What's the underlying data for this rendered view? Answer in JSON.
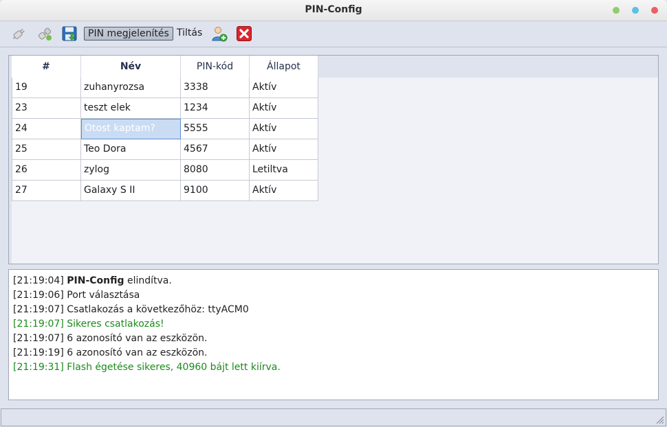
{
  "window": {
    "title": "PIN-Config"
  },
  "colors": {
    "dot_green": "#8fce6a",
    "dot_blue": "#5bc0eb",
    "dot_red": "#ec5f67",
    "success_text": "#1a8a1a"
  },
  "toolbar": {
    "icons": [
      "connect-plug-icon",
      "disconnect-plug-icon",
      "save-disk-icon",
      "add-user-icon",
      "delete-red-x-icon"
    ],
    "show_pin_label": "PIN megjelenítés",
    "block_label": "Tiltás"
  },
  "table": {
    "headers": [
      "#",
      "Név",
      "PIN-kód",
      "Állapot"
    ],
    "rows": [
      {
        "id": "19",
        "name": "zuhanyrozsa",
        "pin": "3338",
        "status": "Aktív"
      },
      {
        "id": "23",
        "name": "teszt elek",
        "pin": "1234",
        "status": "Aktív"
      },
      {
        "id": "24",
        "name": "Otost kaptam?",
        "pin": "5555",
        "status": "Aktív"
      },
      {
        "id": "25",
        "name": "Teo Dora",
        "pin": "4567",
        "status": "Aktív"
      },
      {
        "id": "26",
        "name": "zylog",
        "pin": "8080",
        "status": "Letiltva"
      },
      {
        "id": "27",
        "name": "Galaxy S II",
        "pin": "9100",
        "status": "Aktív"
      }
    ]
  },
  "log": [
    {
      "time": "[21:19:04]",
      "bold": "PIN-Config",
      "text": " elindítva."
    },
    {
      "time": "[21:19:06]",
      "text": " Port választása"
    },
    {
      "time": "[21:19:07]",
      "text": " Csatlakozás a következőhöz: ttyACM0"
    },
    {
      "time": "[21:19:07]",
      "text": " Sikeres csatlakozás!",
      "success": true
    },
    {
      "time": "[21:19:07]",
      "text": " 6 azonosító van az eszközön."
    },
    {
      "time": "[21:19:19]",
      "text": " 6 azonosító van az eszközön."
    },
    {
      "time": "[21:19:31]",
      "text": " Flash égetése sikeres, 40960 bájt lett kiírva.",
      "success": true
    }
  ]
}
